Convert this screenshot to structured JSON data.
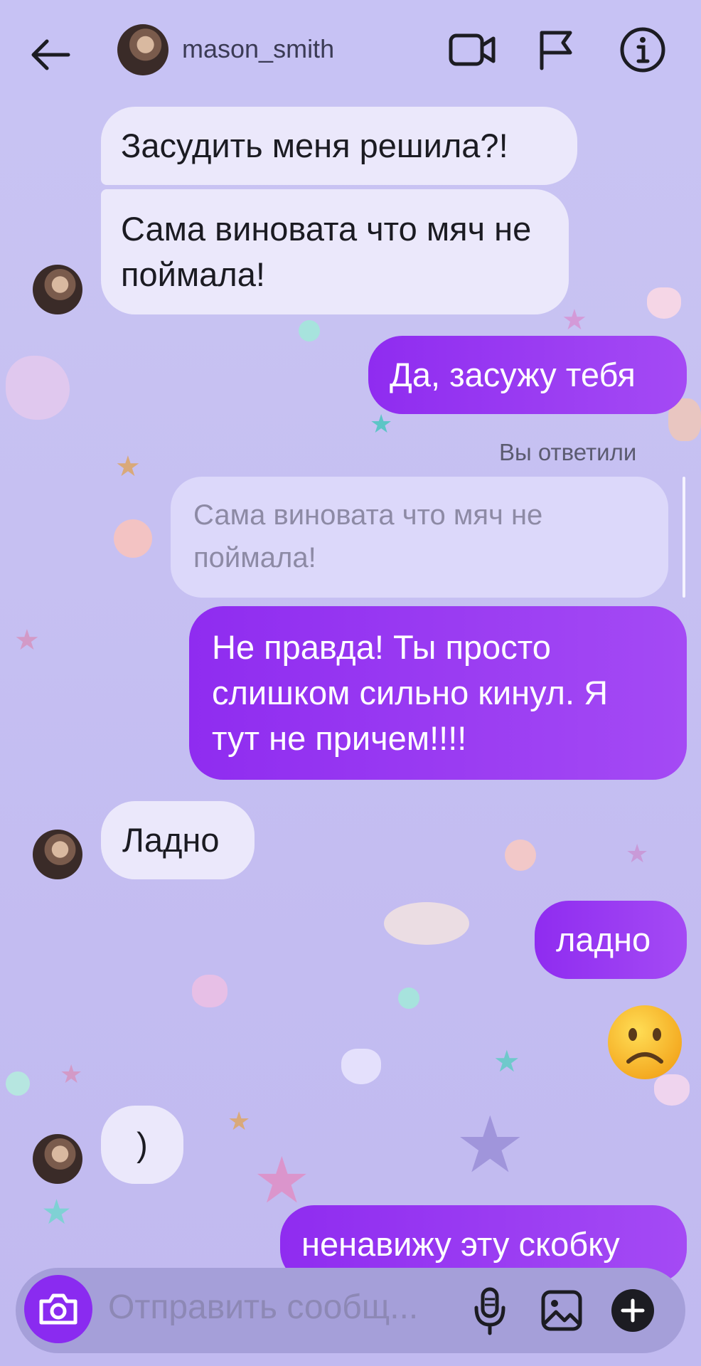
{
  "header": {
    "username": "mason_smith",
    "icons": [
      "back-arrow-icon",
      "video-call-icon",
      "flag-icon",
      "info-icon"
    ]
  },
  "messages": [
    {
      "side": "received",
      "text": "Засудить меня решила?!"
    },
    {
      "side": "received",
      "text": "Сама виновата что мяч не поймала!"
    },
    {
      "side": "sent",
      "text": "Да, засужу тебя"
    },
    {
      "side": "meta",
      "text": "Вы ответили"
    },
    {
      "side": "quote",
      "text": "Сама виновата что мяч не поймала!"
    },
    {
      "side": "sent",
      "text": "Не правда! Ты просто слишком сильно кинул. Я тут не причем!!!!"
    },
    {
      "side": "received",
      "text": "Ладно"
    },
    {
      "side": "sent",
      "text": "ладно"
    },
    {
      "side": "sent_emoji",
      "text": "☹️"
    },
    {
      "side": "received",
      "text": ")"
    },
    {
      "side": "sent",
      "text": "ненавижу эту скобку"
    }
  ],
  "composer": {
    "placeholder": "Отправить сообщ...",
    "icons": [
      "camera-icon",
      "microphone-icon",
      "gallery-icon",
      "plus-icon"
    ]
  },
  "colors": {
    "background": "#c6c0f2",
    "sent_bubble": "#9b3df2",
    "received_bubble": "#ebe8fb",
    "composer": "#a59fd9"
  }
}
